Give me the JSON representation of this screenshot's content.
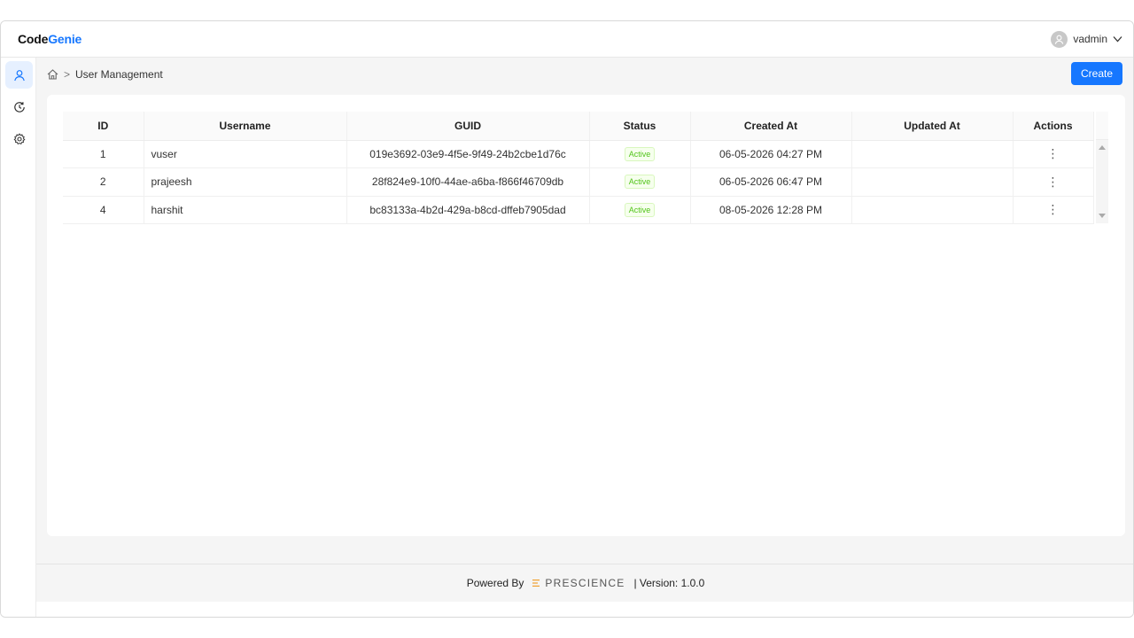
{
  "app": {
    "logo_code": "Code",
    "logo_genie": "Genie",
    "user_name": "vadmin"
  },
  "sidebar": {
    "items": [
      {
        "icon": "user-icon",
        "active": true
      },
      {
        "icon": "history-icon",
        "active": false
      },
      {
        "icon": "gear-icon",
        "active": false
      }
    ]
  },
  "breadcrumb": {
    "separator": ">",
    "current": "User Management"
  },
  "toolbar": {
    "create_label": "Create"
  },
  "table": {
    "columns": [
      "ID",
      "Username",
      "GUID",
      "Status",
      "Created At",
      "Updated At",
      "Actions"
    ],
    "rows": [
      {
        "id": "1",
        "username": "vuser",
        "guid": "019e3692-03e9-4f5e-9f49-24b2cbe1d76c",
        "status": "Active",
        "created_at": "06-05-2026 04:27 PM",
        "updated_at": "",
        "actions": "⋮"
      },
      {
        "id": "2",
        "username": "prajeesh",
        "guid": "28f824e9-10f0-44ae-a6ba-f866f46709db",
        "status": "Active",
        "created_at": "06-05-2026 06:47 PM",
        "updated_at": "",
        "actions": "⋮"
      },
      {
        "id": "4",
        "username": "harshit",
        "guid": "bc83133a-4b2d-429a-b8cd-dffeb7905dad",
        "status": "Active",
        "created_at": "08-05-2026 12:28 PM",
        "updated_at": "",
        "actions": "⋮"
      }
    ]
  },
  "footer": {
    "powered_by": "Powered By",
    "brand": "PRESCIENCE",
    "version": "| Version: 1.0.0"
  },
  "colors": {
    "accent": "#1677ff",
    "status_active": "#52c41a"
  }
}
